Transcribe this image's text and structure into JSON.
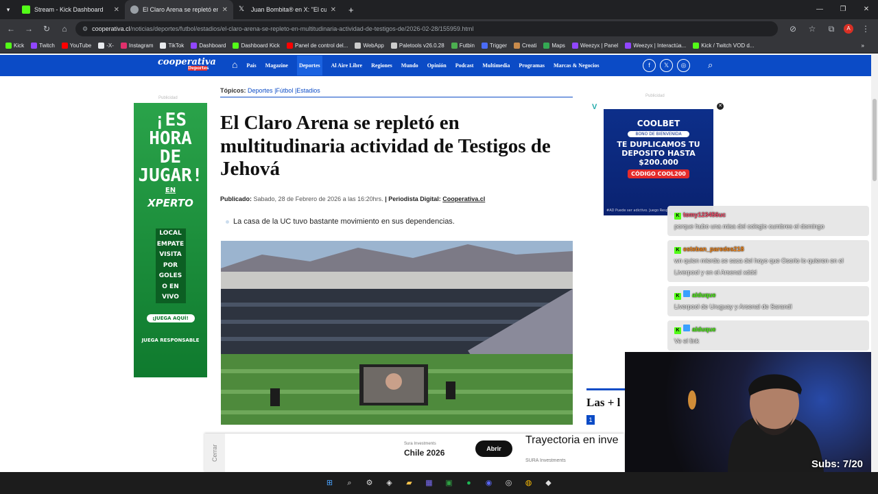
{
  "tabs": [
    {
      "label": "Stream - Kick Dashboard",
      "icon": "kick-icon",
      "color": "#53fc18"
    },
    {
      "label": "El Claro Arena se repletó en mu",
      "icon": "globe-icon",
      "color": "#9aa0a6"
    },
    {
      "label": "Juan Bombita® en X: \"El cuarto",
      "icon": "x-icon",
      "color": "#e8eaed"
    }
  ],
  "address": {
    "domain": "cooperativa.cl",
    "path": "/noticias/deportes/futbol/estadios/el-claro-arena-se-repleto-en-multitudinaria-actividad-de-testigos-de/2026-02-28/155959.html"
  },
  "bookmarks": [
    {
      "label": "Kick",
      "color": "#53fc18"
    },
    {
      "label": "Twitch",
      "color": "#9146ff"
    },
    {
      "label": "YouTube",
      "color": "#ff0000"
    },
    {
      "label": "-X-",
      "color": "#e8eaed"
    },
    {
      "label": "Instagram",
      "color": "#e1306c"
    },
    {
      "label": "TikTok",
      "color": "#e8eaed"
    },
    {
      "label": "Dashboard",
      "color": "#9146ff"
    },
    {
      "label": "Dashboard Kick",
      "color": "#53fc18"
    },
    {
      "label": "Panel de control del...",
      "color": "#ff0000"
    },
    {
      "label": "WebApp",
      "color": "#ccc"
    },
    {
      "label": "Paletools v26.0.28",
      "color": "#ccc"
    },
    {
      "label": "Futbin",
      "color": "#4caf50"
    },
    {
      "label": "Trigger",
      "color": "#4a6cf7"
    },
    {
      "label": "Creati",
      "color": "#c98b4b"
    },
    {
      "label": "Maps",
      "color": "#34a853"
    },
    {
      "label": "Weezyx | Panel",
      "color": "#9146ff"
    },
    {
      "label": "Weezyx | Interactúa...",
      "color": "#9146ff"
    },
    {
      "label": "Kick / Twitch VOD d...",
      "color": "#53fc18"
    }
  ],
  "site": {
    "logo": "cooperativa",
    "logo_sub": "Deportes",
    "menu": [
      "País",
      "Magazine",
      "Deportes",
      "Al Aire Libre",
      "Regiones",
      "Mundo",
      "Opinión",
      "Podcast",
      "Multimedia",
      "Programas",
      "Marcas & Negocios"
    ],
    "menu_active": "Deportes"
  },
  "article": {
    "topics_label": "Tópicos:",
    "topics": [
      "Deportes",
      "|Fútbol",
      "|Estadios"
    ],
    "title": "El Claro Arena se repletó en multitudinaria actividad de Testigos de Jehová",
    "published_label": "Publicado:",
    "published_date": "Sabado, 28 de Febrero de 2026 a las 16:20hrs.",
    "author_label": "| Periodista Digital:",
    "author": "Cooperativa.cl",
    "lead": "La casa de la UC tuvo bastante movimiento en sus dependencias."
  },
  "ads": {
    "label": "Publicidad",
    "left": {
      "headline": "¡ES HORA DE JUGAR!",
      "en": "EN",
      "brand": "XPERTO",
      "items": [
        "LOCAL",
        "EMPATE",
        "VISITA",
        "POR GOLES",
        "O EN VIVO"
      ],
      "cta": "¡JUEGA AQUÍ!",
      "resp": "JUEGA RESPONSABLE"
    },
    "right": {
      "brand": "COOLBET",
      "bono": "BONO DE BIENVENIDA",
      "main": "TE DUPLICAMOS TU DEPOSITO HASTA $200.000",
      "code": "CÓDIGO COOL200",
      "fine": "#AD Puede ser adictivo. Juego Responsable"
    },
    "bottom": {
      "close": "Cerrar",
      "sponsor": "Sura Investments",
      "campaign": "Chile 2026",
      "button": "Abrir",
      "headline": "Trayectoria en inve",
      "sponsor2": "SURA Investments"
    }
  },
  "chat": [
    {
      "user": "tomy123456uc",
      "user_color": "#ff4d6d",
      "badges": [
        "kick"
      ],
      "text": "porque hubo una misa del colegio cumbres el domingo"
    },
    {
      "user": "esteban_paredes218",
      "user_color": "#ff8c1a",
      "badges": [
        "kick"
      ],
      "text": "wn quien mierda se saca del hoyo que Osorio lo quieren en el Liverpool y en el Arsenal xddd"
    },
    {
      "user": "alduque",
      "user_color": "#53fc18",
      "badges": [
        "kick",
        "blue"
      ],
      "text": "Liverpool de Uruguay y Arsenal de Sarandí"
    },
    {
      "user": "alduque",
      "user_color": "#53fc18",
      "badges": [
        "kick",
        "blue"
      ],
      "text": "Ve el link"
    }
  ],
  "sidebar": {
    "most_read": "Las + l",
    "rank": "1"
  },
  "overlay": {
    "subs": "Subs: 7/20"
  },
  "taskbar": [
    "windows-icon",
    "search-icon",
    "settings-icon",
    "app-icon",
    "folder-icon",
    "grid-icon",
    "terminal-icon",
    "spotify-icon",
    "discord-icon",
    "obs-icon",
    "chrome-icon",
    "app2-icon"
  ]
}
